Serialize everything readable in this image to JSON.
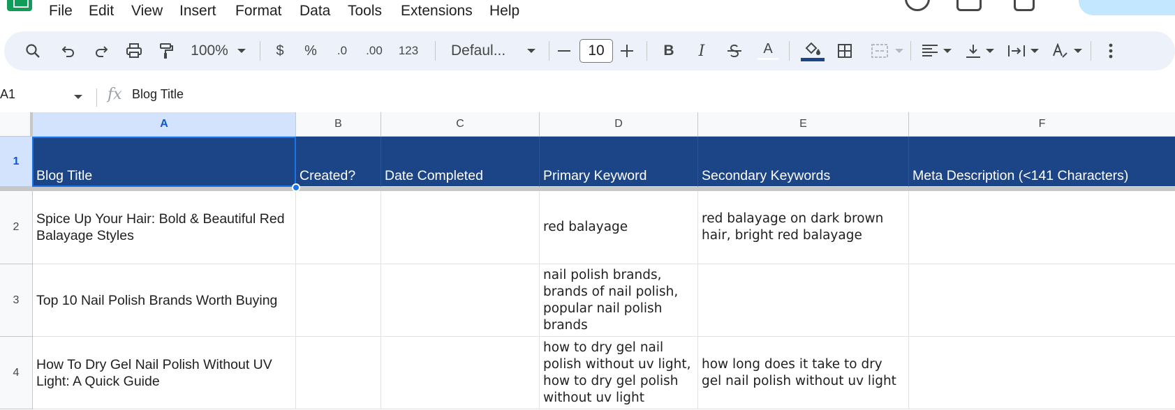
{
  "menu": [
    "File",
    "Edit",
    "View",
    "Insert",
    "Format",
    "Data",
    "Tools",
    "Extensions",
    "Help"
  ],
  "toolbar": {
    "zoom": "100%",
    "currency": "$",
    "percent": "%",
    "decrease_decimal": ".0",
    "increase_decimal": ".00",
    "more_formats": "123",
    "font": "Defaul...",
    "font_size": "10",
    "bold": "B",
    "italic": "I",
    "text_color": "A"
  },
  "formula_bar": {
    "cell_ref": "A1",
    "fx": "fx",
    "value": "Blog Title"
  },
  "columns": [
    "A",
    "B",
    "C",
    "D",
    "E",
    "F"
  ],
  "selected_column": "A",
  "rows": [
    {
      "number": "1",
      "cells": [
        "Blog Title",
        "Created?",
        "Date Completed",
        "Primary Keyword",
        "Secondary Keywords",
        "Meta Description (<141 Characters)"
      ]
    },
    {
      "number": "2",
      "cells": [
        "Spice Up Your Hair: Bold & Beautiful Red Balayage Styles",
        "",
        "",
        "red balayage",
        "red balayage on dark brown hair, bright red balayage",
        ""
      ]
    },
    {
      "number": "3",
      "cells": [
        "Top 10 Nail Polish Brands Worth Buying",
        "",
        "",
        "nail polish brands, brands of nail polish, popular nail polish brands",
        "",
        ""
      ]
    },
    {
      "number": "4",
      "cells": [
        "How To Dry Gel Nail Polish Without UV Light: A Quick Guide",
        "",
        "",
        "how to dry gel nail polish without uv light, how to dry gel polish without uv light",
        "how long does it take to dry gel nail polish without uv light",
        ""
      ]
    }
  ],
  "colors": {
    "header_fill": "#1c4587",
    "selection": "#1a73e8",
    "selected_header": "#d3e3fd",
    "toolbar_bg": "#edf2fa"
  },
  "icons": [
    "search-icon",
    "undo-icon",
    "redo-icon",
    "print-icon",
    "paint-format-icon",
    "fill-color-icon",
    "borders-icon",
    "merge-cells-icon",
    "align-left-icon",
    "valign-bottom-icon",
    "text-wrap-icon",
    "text-rotation-icon",
    "more-vert-icon",
    "fx-icon"
  ]
}
